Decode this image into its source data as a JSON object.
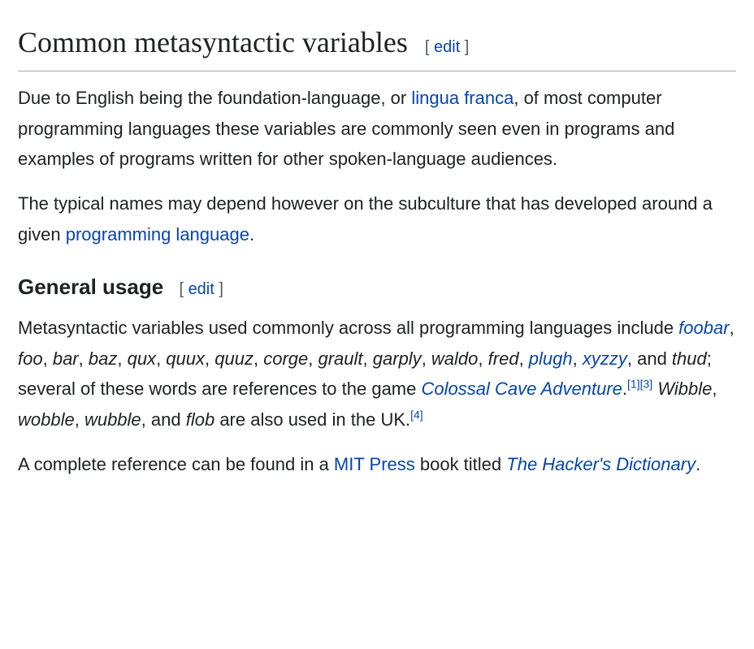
{
  "heading": {
    "title": "Common metasyntactic variables",
    "edit": "edit",
    "bracket_open": "[ ",
    "bracket_close": " ]"
  },
  "para1": {
    "t1": "Due to English being the foundation-language, or ",
    "link1": "lingua franca",
    "t2": ", of most computer programming languages these variables are commonly seen even in programs and examples of programs written for other spoken-language audiences."
  },
  "para2": {
    "t1": "The typical names may depend however on the subculture that has developed around a given ",
    "link1": "programming language",
    "t2": "."
  },
  "sub": {
    "title": "General usage",
    "edit": "edit",
    "bracket_open": "[ ",
    "bracket_close": " ]"
  },
  "para3": {
    "t1": "Metasyntactic variables used commonly across all programming languages include ",
    "vars": {
      "foobar": "foobar",
      "foo": "foo",
      "bar": "bar",
      "baz": "baz",
      "qux": "qux",
      "quux": "quux",
      "quuz": "quuz",
      "corge": "corge",
      "grault": "grault",
      "garply": "garply",
      "waldo": "waldo",
      "fred": "fred",
      "plugh": "plugh",
      "xyzzy": "xyzzy",
      "thud": "thud"
    },
    "sep": ", ",
    "and": ", and ",
    "t2": "; several of these words are references to the game ",
    "game": "Colossal Cave Adventure",
    "period": ".",
    "ref1": "[1]",
    "ref3": "[3]",
    "space": " ",
    "uk": {
      "wibble": "Wibble",
      "wobble": "wobble",
      "wubble": "wubble",
      "flob": "flob"
    },
    "t3": " are also used in the UK.",
    "ref4": "[4]"
  },
  "para4": {
    "t1": "A complete reference can be found in a ",
    "link1": "MIT Press",
    "t2": " book titled ",
    "link2": "The Hacker's Dictionary",
    "t3": "."
  }
}
